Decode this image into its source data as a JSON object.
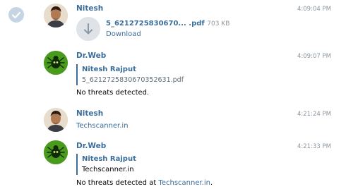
{
  "messages": [
    {
      "sender": "Nitesh",
      "time": "4:09:04 PM",
      "file": {
        "name": "5_6212725830670... .pdf",
        "size": "703 KB",
        "action": "Download"
      }
    },
    {
      "sender": "Dr.Web",
      "time": "4:09:07 PM",
      "reply": {
        "name": "Nitesh Rajput",
        "text": "5_6212725830670352631.pdf"
      },
      "text": "No threats detected."
    },
    {
      "sender": "Nitesh",
      "time": "4:21:24 PM",
      "link": "Techscanner.in"
    },
    {
      "sender": "Dr.Web",
      "time": "4:21:33 PM",
      "reply": {
        "name": "Nitesh Rajput",
        "text": "Techscanner.in"
      },
      "text_prefix": "No threats detected at ",
      "text_link": "Techscanner.in",
      "text_suffix": "."
    }
  ],
  "icons": {
    "selected": "check-circle-icon",
    "file": "download-arrow-icon",
    "bot_avatar": "dr-web-spider-logo"
  },
  "colors": {
    "accent": "#3a6d99",
    "muted": "#8a959e",
    "bot_green": "#4a9a1e"
  }
}
